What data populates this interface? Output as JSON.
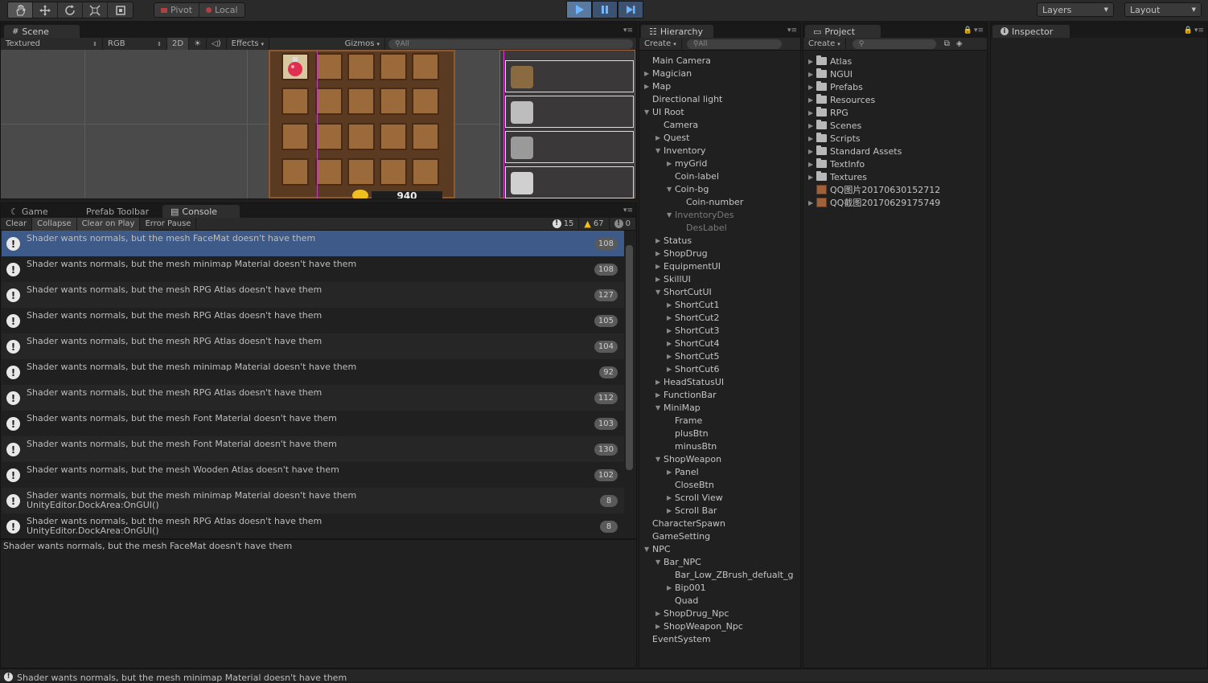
{
  "toolbar": {
    "pivot_label": "Pivot",
    "local_label": "Local",
    "layers_label": "Layers",
    "layout_label": "Layout"
  },
  "scene": {
    "tab_label": "Scene",
    "shading_mode": "Textured",
    "color_mode": "RGB",
    "mode_2d": "2D",
    "effects_label": "Effects",
    "gizmos_label": "Gizmos",
    "search_placeholder": "All",
    "coin_value": "940"
  },
  "bottom_tabs": {
    "game": "Game",
    "prefab_toolbar": "Prefab Toolbar",
    "console": "Console"
  },
  "console": {
    "clear": "Clear",
    "collapse": "Collapse",
    "clear_on_play": "Clear on Play",
    "error_pause": "Error Pause",
    "info_count": "15",
    "warning_count": "67",
    "error_count": "0",
    "rows": [
      {
        "text": "Shader wants normals, but the mesh FaceMat doesn't have them",
        "count": "108"
      },
      {
        "text": "Shader wants normals, but the mesh minimap Material doesn't have them",
        "count": "108"
      },
      {
        "text": "Shader wants normals, but the mesh RPG Atlas doesn't have them",
        "count": "127"
      },
      {
        "text": "Shader wants normals, but the mesh RPG Atlas doesn't have them",
        "count": "105"
      },
      {
        "text": "Shader wants normals, but the mesh RPG Atlas doesn't have them",
        "count": "104"
      },
      {
        "text": "Shader wants normals, but the mesh minimap Material doesn't have them",
        "count": "92"
      },
      {
        "text": "Shader wants normals, but the mesh RPG Atlas doesn't have them",
        "count": "112"
      },
      {
        "text": "Shader wants normals, but the mesh Font Material doesn't have them",
        "count": "103"
      },
      {
        "text": "Shader wants normals, but the mesh Font Material doesn't have them",
        "count": "130"
      },
      {
        "text": "Shader wants normals, but the mesh Wooden Atlas doesn't have them",
        "count": "102"
      },
      {
        "text": "Shader wants normals, but the mesh minimap Material doesn't have them",
        "text2": "UnityEditor.DockArea:OnGUI()",
        "count": "8"
      },
      {
        "text": "Shader wants normals, but the mesh RPG Atlas doesn't have them",
        "text2": "UnityEditor.DockArea:OnGUI()",
        "count": "8"
      }
    ],
    "detail": "Shader wants normals, but the mesh FaceMat doesn't have them"
  },
  "hierarchy": {
    "tab_label": "Hierarchy",
    "create_label": "Create",
    "search_placeholder": "All",
    "items": [
      {
        "label": "Main Camera",
        "depth": 0,
        "arrow": "",
        "dim": false
      },
      {
        "label": "Magician",
        "depth": 0,
        "arrow": "right",
        "dim": false
      },
      {
        "label": "Map",
        "depth": 0,
        "arrow": "right",
        "dim": false
      },
      {
        "label": "Directional light",
        "depth": 0,
        "arrow": "",
        "dim": false
      },
      {
        "label": "UI Root",
        "depth": 0,
        "arrow": "down",
        "dim": false
      },
      {
        "label": "Camera",
        "depth": 1,
        "arrow": "",
        "dim": false
      },
      {
        "label": "Quest",
        "depth": 1,
        "arrow": "right",
        "dim": false
      },
      {
        "label": "Inventory",
        "depth": 1,
        "arrow": "down",
        "dim": false
      },
      {
        "label": "myGrid",
        "depth": 2,
        "arrow": "right",
        "dim": false
      },
      {
        "label": "Coin-label",
        "depth": 2,
        "arrow": "",
        "dim": false
      },
      {
        "label": "Coin-bg",
        "depth": 2,
        "arrow": "down",
        "dim": false
      },
      {
        "label": "Coin-number",
        "depth": 3,
        "arrow": "",
        "dim": false
      },
      {
        "label": "InventoryDes",
        "depth": 2,
        "arrow": "down",
        "dim": true
      },
      {
        "label": "DesLabel",
        "depth": 3,
        "arrow": "",
        "dim": true
      },
      {
        "label": "Status",
        "depth": 1,
        "arrow": "right",
        "dim": false
      },
      {
        "label": "ShopDrug",
        "depth": 1,
        "arrow": "right",
        "dim": false
      },
      {
        "label": "EquipmentUI",
        "depth": 1,
        "arrow": "right",
        "dim": false
      },
      {
        "label": "SkillUI",
        "depth": 1,
        "arrow": "right",
        "dim": false
      },
      {
        "label": "ShortCutUI",
        "depth": 1,
        "arrow": "down",
        "dim": false
      },
      {
        "label": "ShortCut1",
        "depth": 2,
        "arrow": "right",
        "dim": false
      },
      {
        "label": "ShortCut2",
        "depth": 2,
        "arrow": "right",
        "dim": false
      },
      {
        "label": "ShortCut3",
        "depth": 2,
        "arrow": "right",
        "dim": false
      },
      {
        "label": "ShortCut4",
        "depth": 2,
        "arrow": "right",
        "dim": false
      },
      {
        "label": "ShortCut5",
        "depth": 2,
        "arrow": "right",
        "dim": false
      },
      {
        "label": "ShortCut6",
        "depth": 2,
        "arrow": "right",
        "dim": false
      },
      {
        "label": "HeadStatusUI",
        "depth": 1,
        "arrow": "right",
        "dim": false
      },
      {
        "label": "FunctionBar",
        "depth": 1,
        "arrow": "right",
        "dim": false
      },
      {
        "label": "MiniMap",
        "depth": 1,
        "arrow": "down",
        "dim": false
      },
      {
        "label": "Frame",
        "depth": 2,
        "arrow": "",
        "dim": false
      },
      {
        "label": "plusBtn",
        "depth": 2,
        "arrow": "",
        "dim": false
      },
      {
        "label": "minusBtn",
        "depth": 2,
        "arrow": "",
        "dim": false
      },
      {
        "label": "ShopWeapon",
        "depth": 1,
        "arrow": "down",
        "dim": false
      },
      {
        "label": "Panel",
        "depth": 2,
        "arrow": "right",
        "dim": false
      },
      {
        "label": "CloseBtn",
        "depth": 2,
        "arrow": "",
        "dim": false
      },
      {
        "label": "Scroll View",
        "depth": 2,
        "arrow": "right",
        "dim": false
      },
      {
        "label": "Scroll Bar",
        "depth": 2,
        "arrow": "right",
        "dim": false
      },
      {
        "label": "CharacterSpawn",
        "depth": 0,
        "arrow": "",
        "dim": false
      },
      {
        "label": "GameSetting",
        "depth": 0,
        "arrow": "",
        "dim": false
      },
      {
        "label": "NPC",
        "depth": 0,
        "arrow": "down",
        "dim": false
      },
      {
        "label": "Bar_NPC",
        "depth": 1,
        "arrow": "down",
        "dim": false
      },
      {
        "label": "Bar_Low_ZBrush_defualt_g",
        "depth": 2,
        "arrow": "",
        "dim": false
      },
      {
        "label": "Bip001",
        "depth": 2,
        "arrow": "right",
        "dim": false
      },
      {
        "label": "Quad",
        "depth": 2,
        "arrow": "",
        "dim": false
      },
      {
        "label": "ShopDrug_Npc",
        "depth": 1,
        "arrow": "right",
        "dim": false
      },
      {
        "label": "ShopWeapon_Npc",
        "depth": 1,
        "arrow": "right",
        "dim": false
      },
      {
        "label": "EventSystem",
        "depth": 0,
        "arrow": "",
        "dim": false
      }
    ]
  },
  "project": {
    "tab_label": "Project",
    "create_label": "Create",
    "items": [
      {
        "label": "Atlas",
        "type": "folder"
      },
      {
        "label": "NGUI",
        "type": "folder"
      },
      {
        "label": "Prefabs",
        "type": "folder"
      },
      {
        "label": "Resources",
        "type": "folder"
      },
      {
        "label": "RPG",
        "type": "folder"
      },
      {
        "label": "Scenes",
        "type": "folder"
      },
      {
        "label": "Scripts",
        "type": "folder"
      },
      {
        "label": "Standard Assets",
        "type": "folder"
      },
      {
        "label": "TextInfo",
        "type": "folder"
      },
      {
        "label": "Textures",
        "type": "folder"
      },
      {
        "label": "QQ图片20170630152712",
        "type": "image"
      },
      {
        "label": "QQ截图20170629175749",
        "type": "image"
      }
    ]
  },
  "inspector": {
    "tab_label": "Inspector"
  },
  "status": {
    "message": "Shader wants normals, but the mesh minimap Material doesn't have them"
  }
}
